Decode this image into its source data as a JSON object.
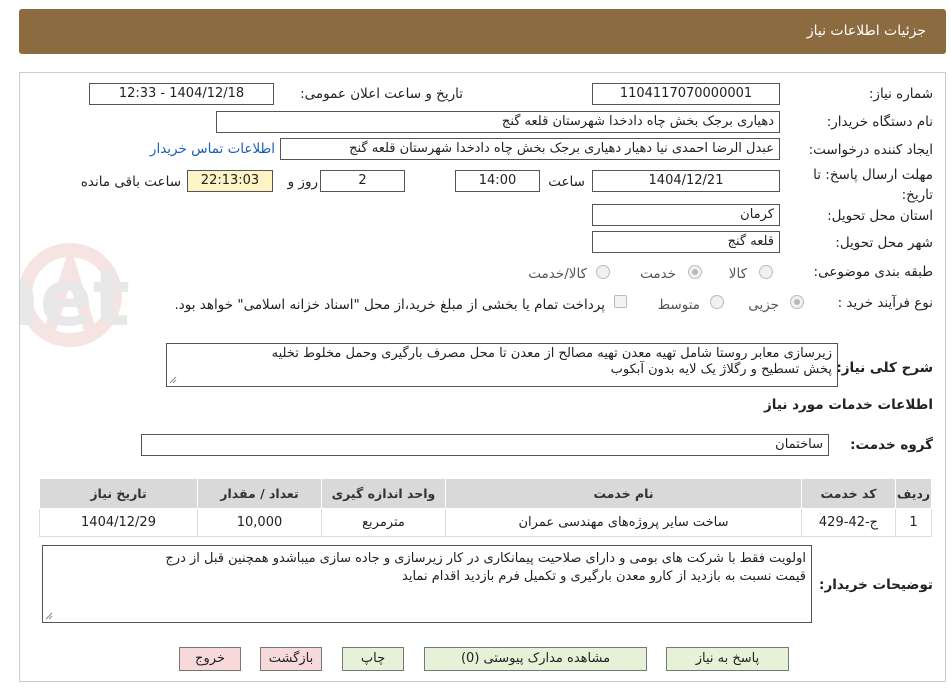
{
  "header": {
    "title": "جزئیات اطلاعات نیاز"
  },
  "form": {
    "need_number_label": "شماره نیاز:",
    "need_number": "1104117070000001",
    "announce_label": "تاریخ و ساعت اعلان عمومی:",
    "announce_value": "1404/12/18 - 12:33",
    "buyer_org_label": "نام دستگاه خریدار:",
    "buyer_org": "دهیاری برجک بخش چاه دادخدا شهرستان قلعه گنج",
    "creator_label": "ایجاد کننده درخواست:",
    "creator": "عبدل الرضا احمدی نیا دهیار دهیاری برجک بخش چاه دادخدا شهرستان قلعه گنج",
    "contact_link": "اطلاعات تماس خریدار",
    "deadline_label": "مهلت ارسال پاسخ: تا تاریخ:",
    "deadline_date": "1404/12/21",
    "time_label": "ساعت",
    "deadline_time": "14:00",
    "days_value": "2",
    "days_label": "روز و",
    "remaining_time": "22:13:03",
    "remaining_label": "ساعت باقی مانده",
    "province_label": "استان محل تحویل:",
    "province": "کرمان",
    "city_label": "شهر محل تحویل:",
    "city": "قلعه گنج",
    "category_label": "طبقه بندی موضوعی:",
    "category_options": [
      "کالا",
      "خدمت",
      "کالا/خدمت"
    ],
    "process_label": "نوع فرآیند خرید :",
    "process_options": [
      "جزیی",
      "متوسط"
    ],
    "payment_note": "پرداخت تمام یا بخشی از مبلغ خرید،از محل \"اسناد خزانه اسلامی\" خواهد بود.",
    "summary_label": "شرح کلی نیاز:",
    "summary_line1": "زیرسازی معابر روستا  شامل تهیه معدن تهیه مصالح  از معدن تا محل مصرف  بارگیری وحمل مخلوط تخلیه",
    "summary_line2": "پخش تسطیح و رگلاژ یک لایه  بدون آبکوب",
    "services_title": "اطلاعات خدمات مورد نیاز",
    "service_group_label": "گروه خدمت:",
    "service_group": "ساختمان"
  },
  "table": {
    "headers": [
      "ردیف",
      "کد خدمت",
      "نام خدمت",
      "واحد اندازه گیری",
      "تعداد / مقدار",
      "تاریخ نیاز"
    ],
    "rows": [
      [
        "1",
        "ج-42-429",
        "ساخت سایر پروژه‌های مهندسی عمران",
        "مترمربع",
        "10,000",
        "1404/12/29"
      ]
    ]
  },
  "buyer_notes": {
    "label": "توضیحات خریدار:",
    "line1": "اولویت فقط  با شرکت های بومی و  دارای صلاحیت پیمانکاری در کار زیرسازی و جاده سازی میباشدو همچنین قبل از درج",
    "line2": "قیمت نسبت به بازدید از کارو معدن بارگیری و تکمیل فرم بازدید اقدام نماید"
  },
  "buttons": {
    "reply": "پاسخ به نیاز",
    "attachments": "مشاهده مدارک پیوستی (0)",
    "print": "چاپ",
    "back": "بازگشت",
    "exit": "خروج"
  },
  "watermark": {
    "text": "AnaTender.net"
  },
  "colors": {
    "header": "#8b6b3f",
    "button": "#e6f2d8",
    "button_alert": "#f8d9d9",
    "highlight": "#fdf3c5",
    "link": "#1a5fb4"
  }
}
